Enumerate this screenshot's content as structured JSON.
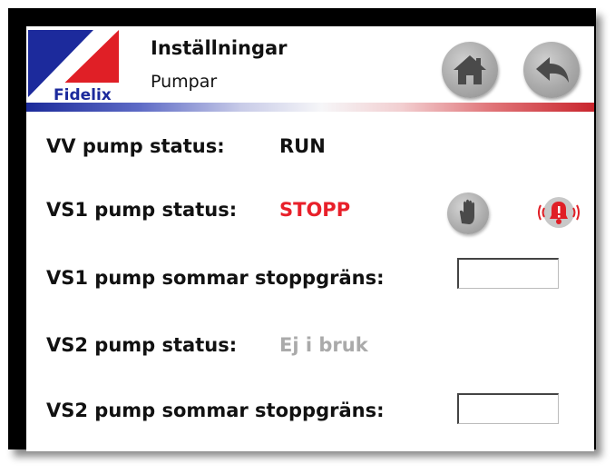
{
  "header": {
    "logo_text": "Fidelix",
    "title": "Inställningar",
    "subtitle": "Pumpar",
    "home_icon": "home-icon",
    "back_icon": "back-arrow-icon"
  },
  "rows": [
    {
      "label": "VV pump status:",
      "value": "RUN",
      "value_color": "#111111"
    },
    {
      "label": "VS1 pump status:",
      "value": "STOPP",
      "value_color": "#e8202a"
    },
    {
      "label": "VS1 pump sommar stoppgräns:",
      "input_value": ""
    },
    {
      "label": "VS2 pump status:",
      "value": "Ej i bruk",
      "value_color": "#aaaaaa"
    },
    {
      "label": "VS2 pump sommar stoppgräns:",
      "input_value": ""
    }
  ],
  "icons": {
    "manual": "hand-icon",
    "alarm": "alarm-bell-icon"
  },
  "colors": {
    "brand_blue": "#1c2a9c",
    "brand_red": "#e01f26",
    "status_stopp": "#e8202a",
    "status_disabled": "#aaaaaa"
  }
}
